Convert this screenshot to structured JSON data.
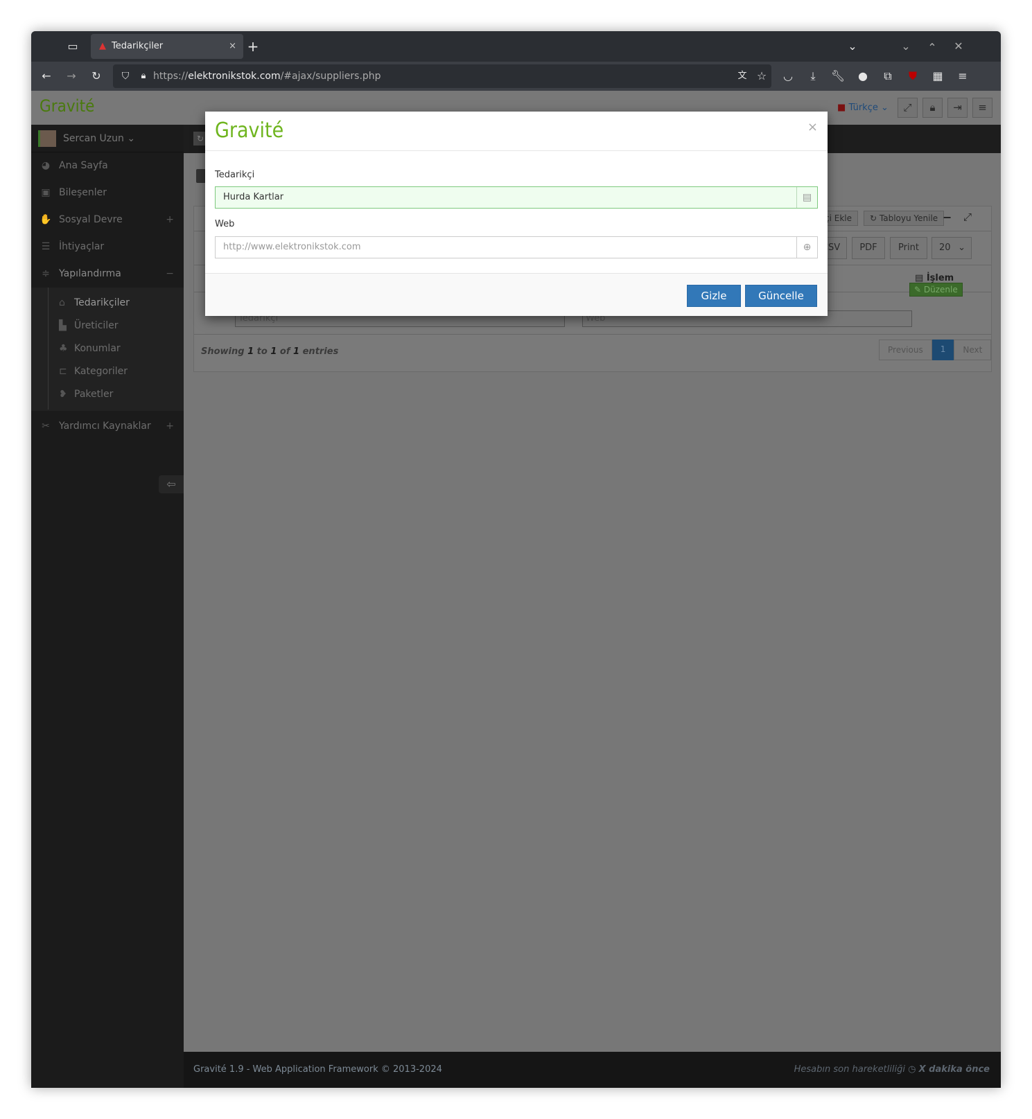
{
  "browser": {
    "tab_title": "Tedarikçiler",
    "url_prefix": "https://",
    "url_host": "elektronikstok.com",
    "url_path": "/#ajax/suppliers.php"
  },
  "app": {
    "logo": "Gravité",
    "language": "Türkçe",
    "user": "Sercan Uzun"
  },
  "sidebar": {
    "items": [
      {
        "label": "Ana Sayfa",
        "icon": "dashboard-icon"
      },
      {
        "label": "Bileşenler",
        "icon": "chip-icon"
      },
      {
        "label": "Sosyal Devre",
        "icon": "handshake-icon",
        "toggle": "+"
      },
      {
        "label": "İhtiyaçlar",
        "icon": "checklist-icon"
      },
      {
        "label": "Yapılandırma",
        "icon": "sliders-icon",
        "toggle": "−"
      }
    ],
    "sub_items": [
      {
        "label": "Tedarikçiler"
      },
      {
        "label": "Üreticiler"
      },
      {
        "label": "Konumlar"
      },
      {
        "label": "Kategoriler"
      },
      {
        "label": "Paketler"
      }
    ],
    "tools": {
      "label": "Yardımcı Kaynaklar",
      "toggle": "+"
    }
  },
  "table": {
    "add_label": "Tedarikçi Ekle",
    "add_visible": "kçi Ekle",
    "refresh_label": "Tabloyu Yenile",
    "export": [
      "CSV",
      "PDF",
      "Print"
    ],
    "page_size": "20",
    "action_header": "İşlem",
    "edit_label": "Düzenle",
    "filter_supplier": "Tedarikçi",
    "filter_web": "Web",
    "info_pre": "Showing ",
    "info_from": "1",
    "info_to_word": " to ",
    "info_to": "1",
    "info_of_word": " of ",
    "info_total": "1",
    "info_post": " entries",
    "prev": "Previous",
    "page": "1",
    "next": "Next"
  },
  "footer": {
    "left": "Gravité 1.9 - Web Application Framework © 2013-2024",
    "right_label": "Hesabın son hareketliliği",
    "right_time": "X dakika önce"
  },
  "modal": {
    "title": "Gravité",
    "close": "×",
    "supplier_label": "Tedarikçi",
    "supplier_value": "Hurda Kartlar",
    "web_label": "Web",
    "web_placeholder": "http://www.elektronikstok.com",
    "hide_button": "Gizle",
    "update_button": "Güncelle"
  }
}
